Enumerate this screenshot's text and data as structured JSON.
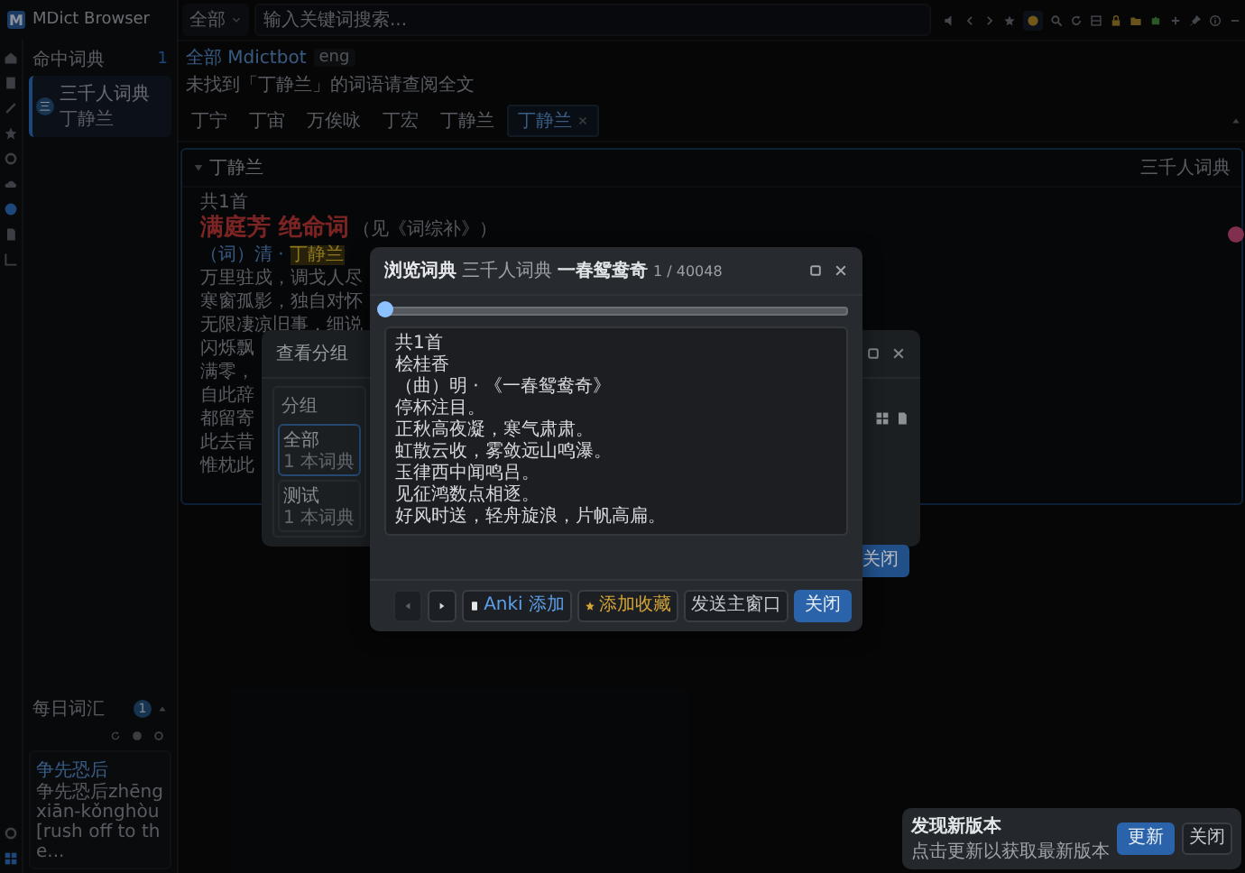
{
  "app": {
    "logo": "M",
    "title": "MDict Browser"
  },
  "sidebar": {
    "title": "命中词典",
    "count": "1",
    "items": [
      {
        "avatar": "三",
        "name": "三千人词典",
        "sub": "丁静兰",
        "selected": true
      }
    ]
  },
  "daily": {
    "title": "每日词汇",
    "badge": "1",
    "word": "争先恐后",
    "definition": "争先恐后zhēngxiān-kǒnghòu[rush off to the..."
  },
  "search": {
    "scope": "全部",
    "placeholder": "输入关键词搜索..."
  },
  "info": {
    "label": "全部 Mdictbot",
    "select": "eng",
    "note": "未找到「丁静兰」的词语请查阅全文"
  },
  "tabs": [
    {
      "label": "丁宁",
      "selected": false,
      "closable": false
    },
    {
      "label": "丁宙",
      "selected": false,
      "closable": false
    },
    {
      "label": "万俟咏",
      "selected": false,
      "closable": false
    },
    {
      "label": "丁宏",
      "selected": false,
      "closable": false
    },
    {
      "label": "丁静兰",
      "selected": false,
      "closable": false
    },
    {
      "label": "丁静兰",
      "selected": true,
      "closable": true
    }
  ],
  "entry": {
    "header": "丁静兰",
    "expanded": true,
    "dictionary": "三千人词典",
    "count": "共1首",
    "title": "满庭芳 绝命词",
    "source": "（见《词综补》）",
    "byline": "（词）清 · ",
    "author": "丁静兰",
    "lines": [
      "万里驻戍，调戈人尽",
      "寒窗孤影，独自对怀",
      "无限凄凉旧事，细说",
      "闪烁飘",
      "满零，",
      "自此辞",
      "都留寄",
      "此去昔",
      "惟枕此"
    ]
  },
  "groups_dialog": {
    "title": "查看分组",
    "column": "分组",
    "groups": [
      {
        "name": "全部",
        "count": "1 本词典",
        "selected": true
      },
      {
        "name": "测试",
        "count": "1 本词典",
        "selected": false
      }
    ],
    "close": "关闭"
  },
  "browse_dialog": {
    "title": "浏览词典",
    "dictionary": "三千人词典",
    "word": "一春鸳鸯奇",
    "position": "1 / 40048",
    "slider": {
      "level": 0
    },
    "lines": [
      "共1首",
      "桧桂香",
      "（曲）明 · 《一春鸳鸯奇》",
      "停杯注目。",
      "正秋高夜凝，寒气肃肃。",
      "虹散云收，雾敛远山鸣瀑。",
      "玉律西中闻鸣吕。",
      "见征鸿数点相逐。",
      "好风时送，轻舟旋浪，片帆高扁。"
    ],
    "buttons": [
      {
        "kind": "prev",
        "disabled": true
      },
      {
        "kind": "next",
        "disabled": false
      },
      {
        "kind": "anki",
        "label": "Anki 添加"
      },
      {
        "kind": "favorite",
        "label": "添加收藏"
      },
      {
        "kind": "send",
        "label": "发送主窗口"
      },
      {
        "kind": "close",
        "label": "关闭"
      }
    ]
  },
  "toast": {
    "title": "发现新版本",
    "message": "点击更新以获取最新版本",
    "buttons": [
      {
        "kind": "primary",
        "label": "更新"
      },
      {
        "kind": "plain",
        "label": "关闭"
      }
    ]
  }
}
